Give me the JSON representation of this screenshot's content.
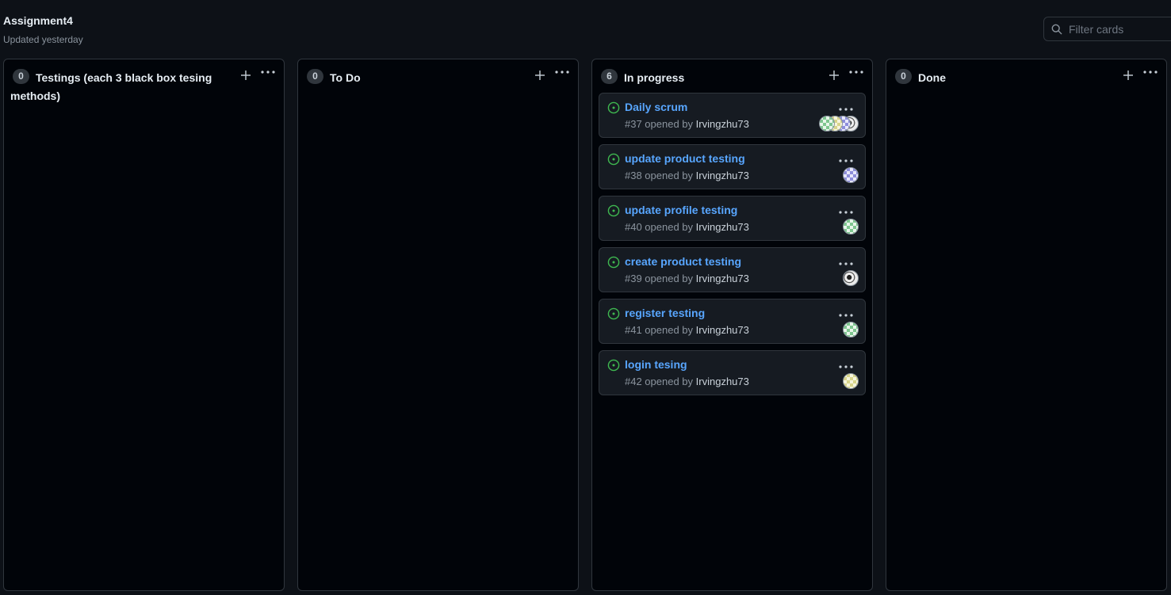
{
  "project": {
    "title": "Assignment4",
    "updated": "Updated yesterday"
  },
  "filter": {
    "placeholder": "Filter cards"
  },
  "colors": {
    "background": "#0d1117",
    "column_background": "#010409",
    "card_background": "#161b22",
    "border": "#30363d",
    "link_blue": "#58a6ff",
    "open_issue_green": "#3fb950"
  },
  "columns": [
    {
      "count": "0",
      "title": "Testings (each 3 black box tesing methods)",
      "cards": []
    },
    {
      "count": "0",
      "title": "To Do",
      "cards": []
    },
    {
      "count": "6",
      "title": "In progress",
      "cards": [
        {
          "title": "Daily scrum",
          "meta": "#37 opened by",
          "author": "Irvingzhu73",
          "avatars": [
            "green",
            "yellow",
            "purple",
            "sketch"
          ]
        },
        {
          "title": "update product testing",
          "meta": "#38 opened by",
          "author": "Irvingzhu73",
          "avatars": [
            "purple"
          ]
        },
        {
          "title": "update profile testing",
          "meta": "#40 opened by",
          "author": "Irvingzhu73",
          "avatars": [
            "green"
          ]
        },
        {
          "title": "create product testing",
          "meta": "#39 opened by",
          "author": "Irvingzhu73",
          "avatars": [
            "sketch"
          ]
        },
        {
          "title": "register testing",
          "meta": "#41 opened by",
          "author": "Irvingzhu73",
          "avatars": [
            "green"
          ]
        },
        {
          "title": "login tesing",
          "meta": "#42 opened by",
          "author": "Irvingzhu73",
          "avatars": [
            "yellow"
          ]
        }
      ]
    },
    {
      "count": "0",
      "title": "Done",
      "cards": []
    }
  ],
  "icons": {
    "search": "search-icon",
    "add": "plus-icon",
    "more": "kebab-horizontal-icon",
    "issue": "issue-opened-icon"
  }
}
